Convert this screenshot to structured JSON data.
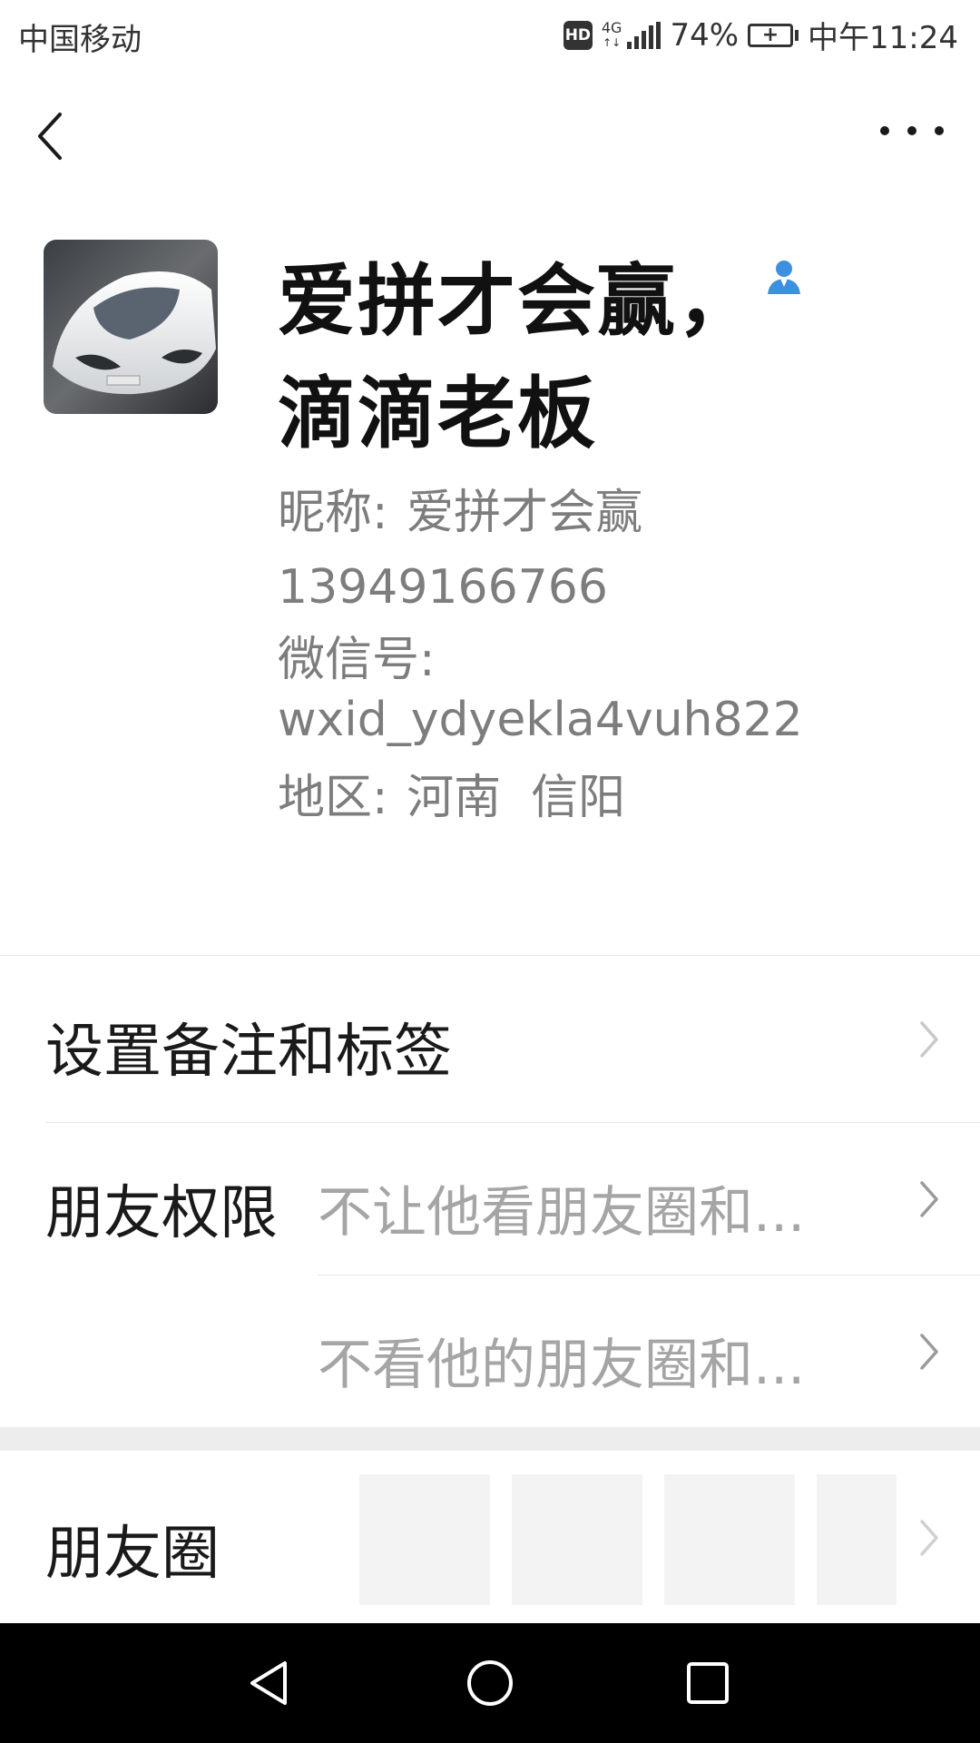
{
  "status_bar": {
    "carrier": "中国移动",
    "hd": "HD",
    "network": "4G",
    "battery": "74%",
    "time": "中午11:24"
  },
  "icons": {
    "back": "back-arrow-icon",
    "more": "more-dots-icon",
    "contact": "person-icon",
    "chevron": "chevron-right-icon"
  },
  "profile": {
    "name_line1": "爱拼才会赢，",
    "name_line2": "滴滴老板",
    "nickname_label": "昵称:",
    "nickname": "爱拼才会赢",
    "phone": "13949166766",
    "wechat_id_label": "微信号:",
    "wechat_id": "wxid_ydyekla4vuh822",
    "region_label": "地区:",
    "region": "河南  信阳"
  },
  "list": {
    "remark_label": "设置备注和标签",
    "permission_label": "朋友权限",
    "permission_value_1": "不让他看朋友圈和...",
    "permission_value_2": "不看他的朋友圈和...",
    "moments_label": "朋友圈"
  },
  "colors": {
    "accent_blue": "#3d8fe0",
    "secondary_text": "#7d7d7d",
    "nav_bar": "#000000"
  }
}
